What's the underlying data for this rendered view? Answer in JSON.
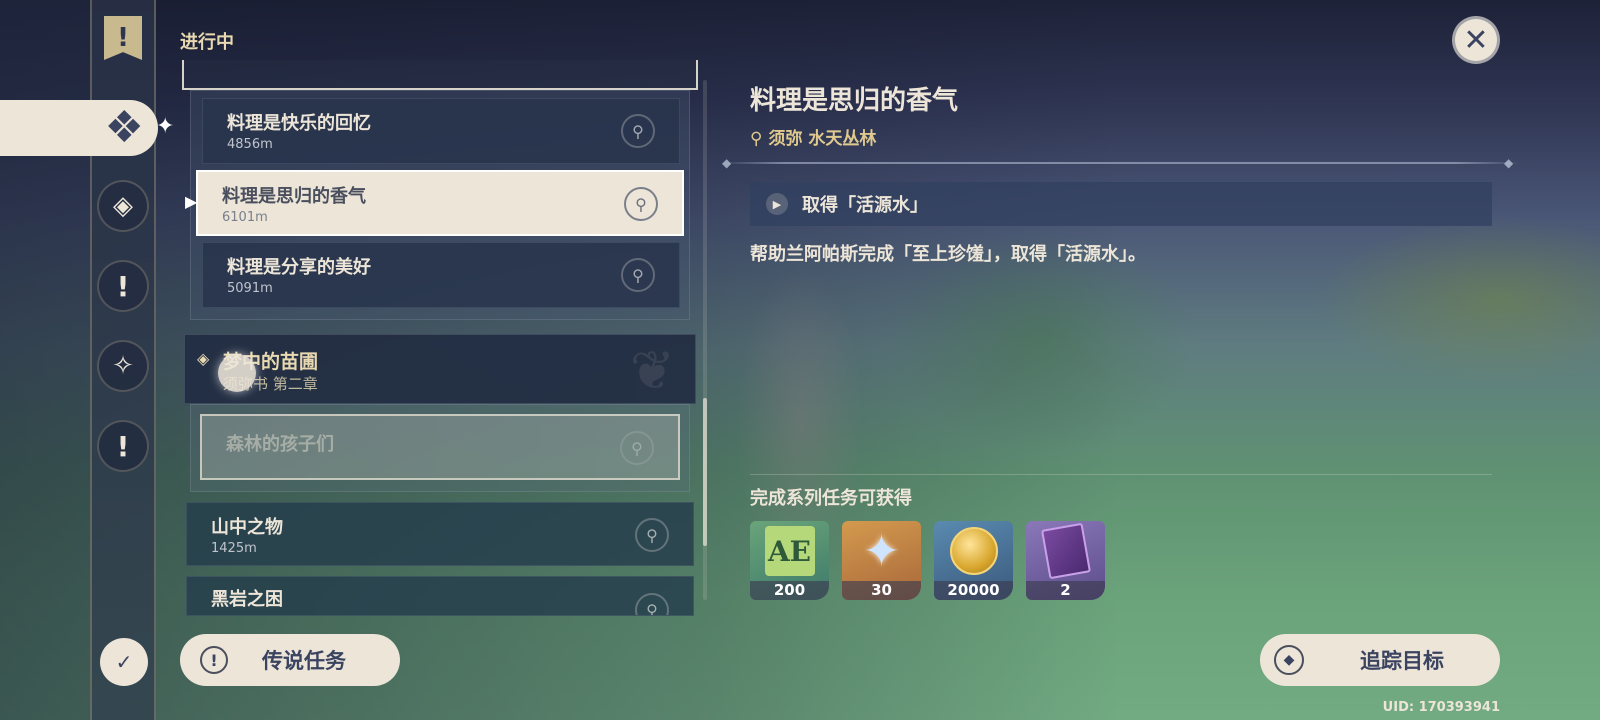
{
  "header": {
    "section_label": "进行中"
  },
  "quest_list": {
    "group1_items": [
      {
        "name": "料理是快乐的回忆",
        "distance": "4856m"
      },
      {
        "name": "料理是思归的香气",
        "distance": "6101m"
      },
      {
        "name": "料理是分享的美好",
        "distance": "5091m"
      }
    ],
    "chapter": {
      "title": "梦中的苗圃",
      "subtitle": "须弥书 第二章"
    },
    "chapter_item": {
      "name": "森林的孩子们"
    },
    "other_items": [
      {
        "name": "山中之物",
        "distance": "1425m"
      },
      {
        "name": "黑岩之困",
        "distance": ""
      }
    ]
  },
  "legend_button": {
    "label": "传说任务",
    "icon": "exclamation-icon"
  },
  "detail": {
    "title": "料理是思归的香气",
    "location": "须弥 水天丛林",
    "objective": "取得「活源水」",
    "description": "帮助兰阿帕斯完成「至上珍馐」，取得「活源水」。",
    "rewards_label": "完成系列任务可获得",
    "rewards": [
      {
        "item": "adventure-exp",
        "count": "200"
      },
      {
        "item": "primogem",
        "count": "30"
      },
      {
        "item": "mora",
        "count": "20000"
      },
      {
        "item": "book",
        "count": "2"
      }
    ]
  },
  "track_button": {
    "label": "追踪目标"
  },
  "uid": "UID: 170393941",
  "colors": {
    "cream": "#ece5d8",
    "gold": "#e0c98f",
    "navy": "#3a4360"
  }
}
